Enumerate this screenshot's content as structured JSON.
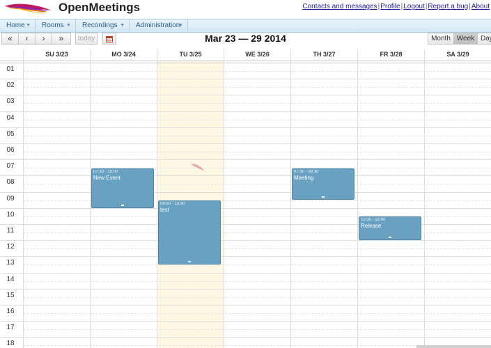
{
  "app": {
    "title": "OpenMeetings",
    "links": [
      "Contacts and messages",
      "Profile",
      "Logout",
      "Report a bug",
      "About"
    ]
  },
  "menu": [
    "Home",
    "Rooms",
    "Recordings",
    "Administration"
  ],
  "toolbar": {
    "prev_year": "«",
    "prev": "‹",
    "next": "›",
    "next_year": "»",
    "today": "today",
    "calendar_icon": "calendar-icon",
    "title": "Mar 23 — 29 2014",
    "views": [
      "Month",
      "Week",
      "Day"
    ],
    "active_view": "Week"
  },
  "days": [
    "SU 3/23",
    "MO 3/24",
    "TU 3/25",
    "WE 3/26",
    "TH 3/27",
    "FR 3/28",
    "SA 3/29"
  ],
  "hours": [
    "01",
    "02",
    "03",
    "04",
    "05",
    "06",
    "07",
    "08",
    "09",
    "10",
    "11",
    "12",
    "13",
    "14",
    "15",
    "16",
    "17",
    "18"
  ],
  "today_index": 2,
  "events": [
    {
      "day": 1,
      "start": 7.5,
      "end": 10,
      "time": "07:30 - 10:00",
      "title": "New Event"
    },
    {
      "day": 2,
      "start": 9.5,
      "end": 13.5,
      "time": "09:30 - 13:30",
      "title": "test"
    },
    {
      "day": 4,
      "start": 7.5,
      "end": 9.5,
      "time": "07:30 - 09:30",
      "title": "Meeting"
    },
    {
      "day": 5,
      "start": 10.5,
      "end": 12,
      "time": "10:30 - 12:00",
      "title": "Release"
    }
  ],
  "colors": {
    "event": "#68a1c2",
    "today": "#fcf8e3",
    "link": "#1a1a9c"
  }
}
